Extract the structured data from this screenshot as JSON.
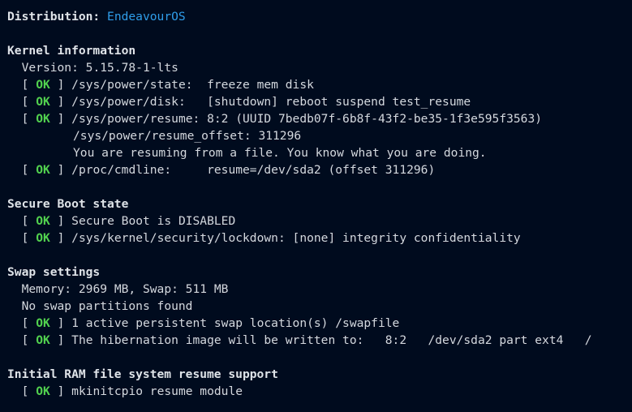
{
  "distribution": {
    "label": "Distribution:",
    "value": "EndeavourOS"
  },
  "status_ok": "OK",
  "bracket_open": "[",
  "bracket_close": "]",
  "kernel": {
    "title": "Kernel information",
    "version": "Version: 5.15.78-1-lts",
    "checks": [
      "/sys/power/state:  freeze mem disk",
      "/sys/power/disk:   [shutdown] reboot suspend test_resume",
      "/sys/power/resume: 8:2 (UUID 7bedb07f-6b8f-43f2-be35-1f3e595f3563)"
    ],
    "resume_offset": "/sys/power/resume_offset: 311296",
    "resume_note": "You are resuming from a file. You know what you are doing.",
    "cmdline": "/proc/cmdline:     resume=/dev/sda2 (offset 311296)"
  },
  "secure_boot": {
    "title": "Secure Boot state",
    "checks": [
      "Secure Boot is DISABLED",
      "/sys/kernel/security/lockdown: [none] integrity confidentiality"
    ]
  },
  "swap": {
    "title": "Swap settings",
    "memory": "Memory: 2969 MB, Swap: 511 MB",
    "partitions": "No swap partitions found",
    "checks": [
      "1 active persistent swap location(s) /swapfile",
      "The hibernation image will be written to:   8:2   /dev/sda2 part ext4   /"
    ]
  },
  "initramfs": {
    "title": "Initial RAM file system resume support",
    "checks": [
      "mkinitcpio resume module"
    ]
  },
  "colors": {
    "background": "#000b1e",
    "text": "#d4d8de",
    "ok": "#52d24f",
    "accent": "#2f9de9"
  }
}
